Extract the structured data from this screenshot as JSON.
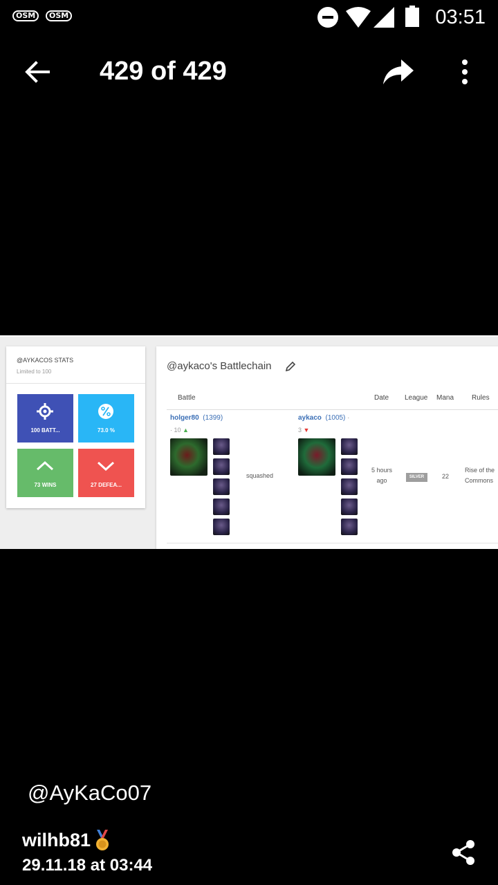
{
  "status_bar": {
    "notifications": [
      "OSM",
      "OSM"
    ],
    "time": "03:51",
    "icons": [
      "dnd-icon",
      "wifi-icon",
      "signal-icon",
      "battery-icon"
    ]
  },
  "toolbar": {
    "title": "429 of 429",
    "icons": [
      "back-arrow-icon",
      "forward-share-icon",
      "more-vert-icon"
    ]
  },
  "embedded": {
    "stats": {
      "title": "@AYKACOS STATS",
      "subtitle": "Limited to 100",
      "tiles": [
        {
          "label": "100 BATT...",
          "icon": "target-icon",
          "color": "#3f51b5"
        },
        {
          "label": "73.0 %",
          "icon": "percent-icon",
          "color": "#29b6f6"
        },
        {
          "label": "73 WINS",
          "icon": "chevron-up-icon",
          "color": "#66bb6a"
        },
        {
          "label": "27 DEFEA...",
          "icon": "chevron-down-icon",
          "color": "#ef5350"
        }
      ]
    },
    "battlechain": {
      "title": "@aykaco's Battlechain",
      "columns": [
        "Battle",
        "Date",
        "League",
        "Mana",
        "Rules"
      ],
      "row": {
        "player1": {
          "name": "holger80",
          "rating": "(1399)",
          "level": "· 10"
        },
        "result": "squashed",
        "player2": {
          "name": "aykaco",
          "rating": "(1005)",
          "extra": "·",
          "level": "3"
        },
        "date_line1": "5 hours",
        "date_line2": "ago",
        "league": "SILVER",
        "mana": "22",
        "rules_line1": "Rise of the",
        "rules_line2": "Commons"
      }
    }
  },
  "footer": {
    "caption": "@AyKaCo07",
    "author": "wilhb81",
    "datetime": "29.11.18 at 03:44",
    "icons": [
      "medal-icon",
      "share-icon"
    ]
  }
}
